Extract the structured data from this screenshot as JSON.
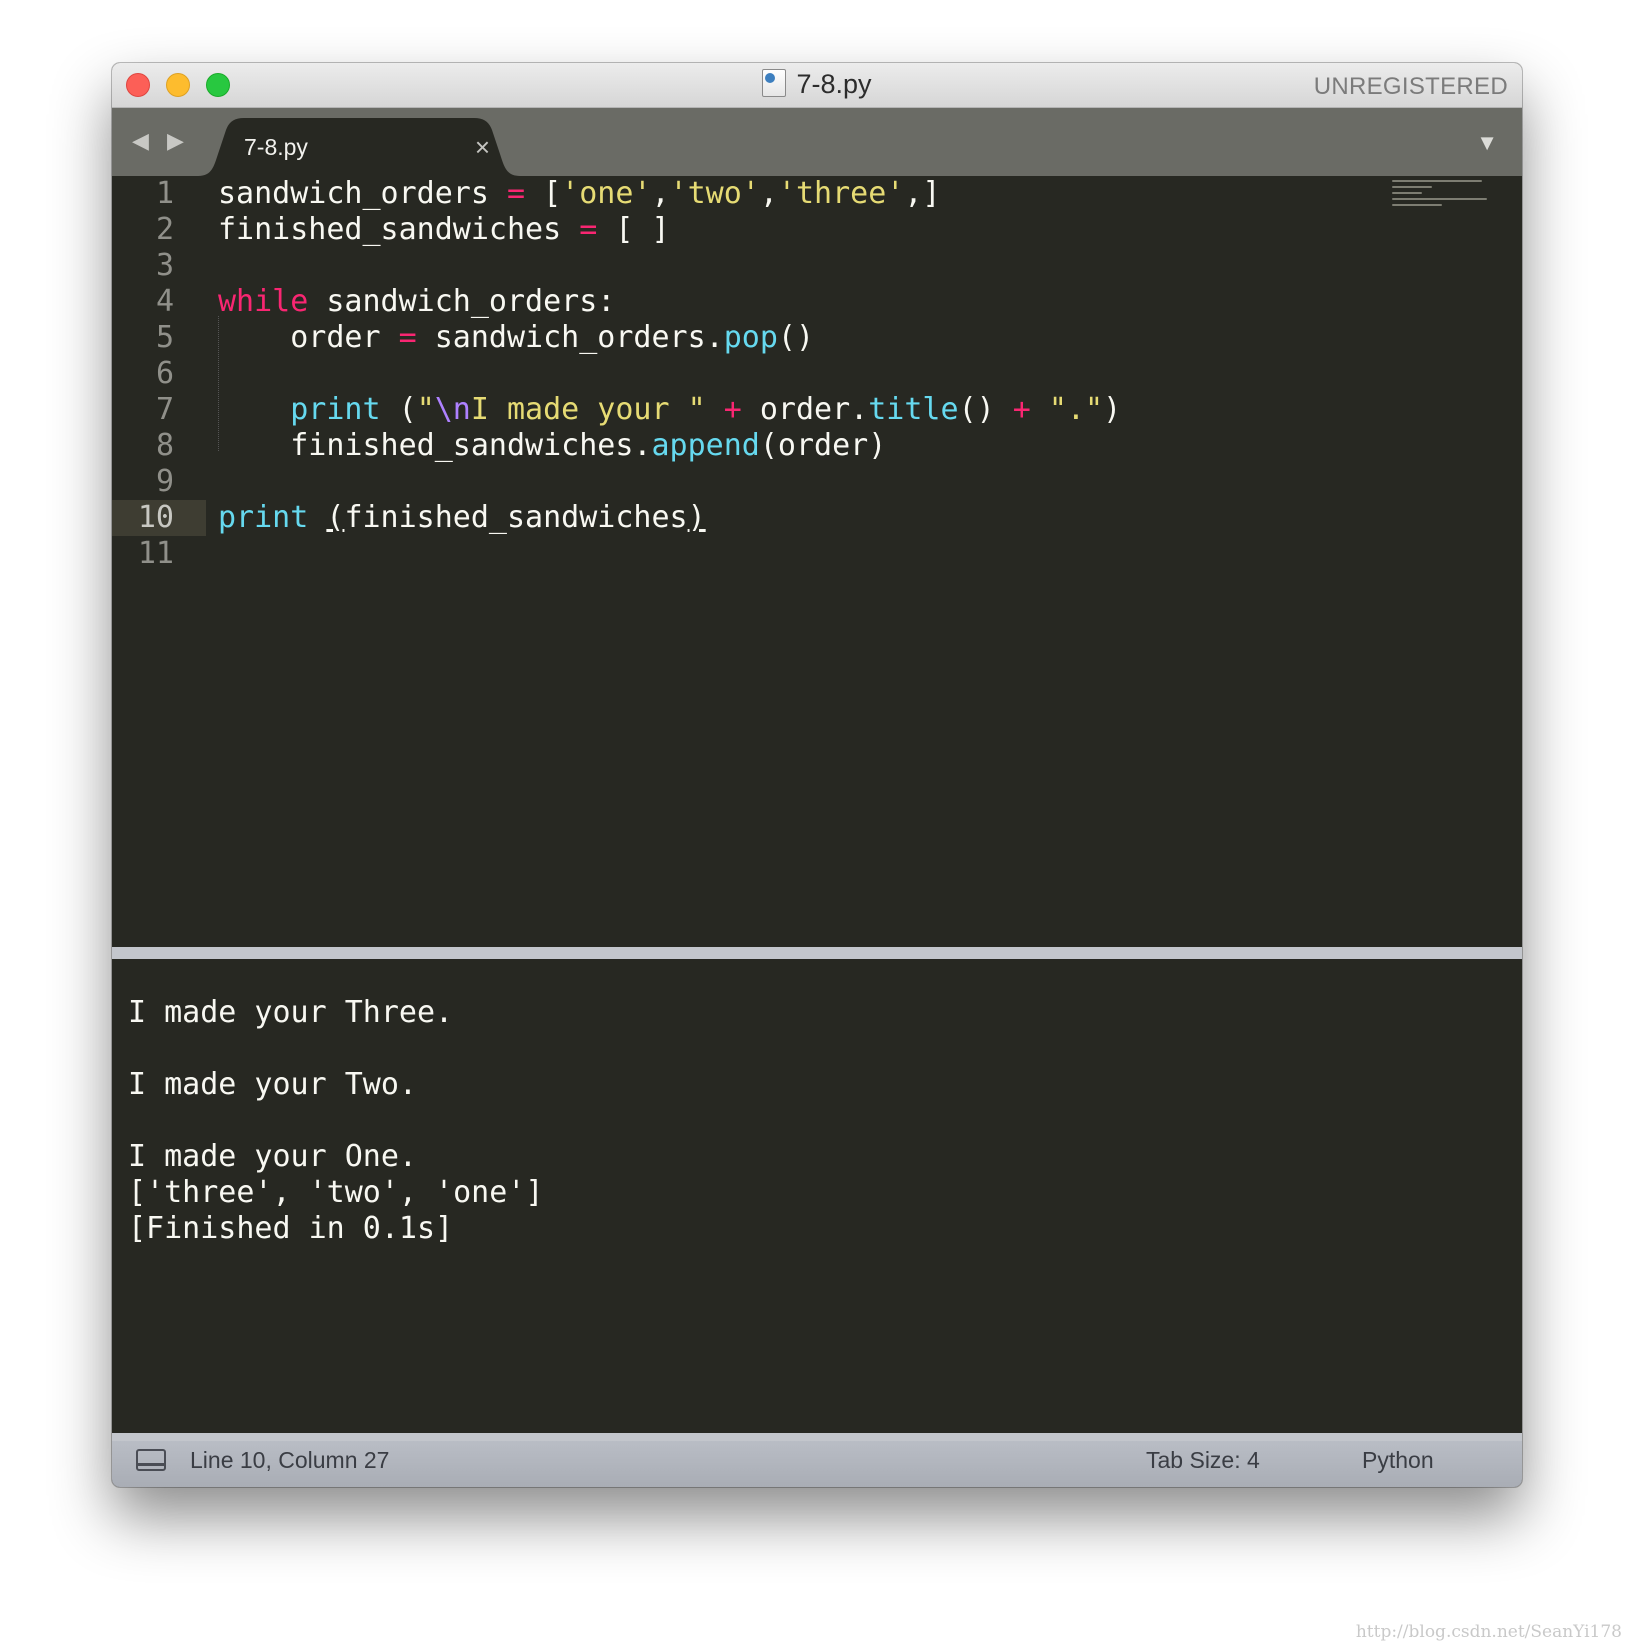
{
  "window": {
    "title": "7-8.py",
    "registration": "UNREGISTERED"
  },
  "tabs": [
    {
      "label": "7-8.py",
      "close_glyph": "×",
      "active": true
    }
  ],
  "tabbar": {
    "nav_glyphs": "◀ ▶",
    "dropdown_glyph": "▼"
  },
  "editor": {
    "current_line": 10,
    "lines": [
      {
        "num": "1"
      },
      {
        "num": "2"
      },
      {
        "num": "3"
      },
      {
        "num": "4"
      },
      {
        "num": "5"
      },
      {
        "num": "6"
      },
      {
        "num": "7"
      },
      {
        "num": "8"
      },
      {
        "num": "9"
      },
      {
        "num": "10"
      },
      {
        "num": "11"
      }
    ],
    "code": {
      "l1": {
        "a": "sandwich_orders ",
        "op": "=",
        "b": " [",
        "s1": "'one'",
        "c1": ",",
        "s2": "'two'",
        "c2": ",",
        "s3": "'three'",
        "end": ",]"
      },
      "l2": {
        "a": "finished_sandwiches ",
        "op": "=",
        "b": " [ ]"
      },
      "l4": {
        "kw": "while",
        "rest": " sandwich_orders:"
      },
      "l5": {
        "a": "    order ",
        "op": "=",
        "b": " sandwich_orders.",
        "fn": "pop",
        "end": "()"
      },
      "l7": {
        "indent": "    ",
        "fn": "print",
        "b": " (",
        "s1": "\"",
        "esc": "\\n",
        "s2": "I made your \"",
        "op1": " +",
        "c": " order.",
        "fn2": "title",
        "d": "()",
        "op2": " +",
        "s3": " \".\"",
        "end": ")"
      },
      "l8": {
        "a": "    finished_sandwiches.",
        "fn": "append",
        "end": "(order)"
      },
      "l10": {
        "fn": "print",
        "sp": " ",
        "paren_open": "(",
        "mid": "finished_sandwiches",
        "paren_close": ")"
      }
    }
  },
  "output": {
    "lines": [
      "",
      "I made your Three.",
      "",
      "I made your Two.",
      "",
      "I made your One.",
      "['three', 'two', 'one']",
      "[Finished in 0.1s]"
    ]
  },
  "statusbar": {
    "position": "Line 10, Column 27",
    "tab_size": "Tab Size: 4",
    "syntax": "Python"
  },
  "watermark": "http://blog.csdn.net/SeanYi178",
  "colors": {
    "background": "#272822",
    "keyword": "#f92672",
    "function": "#66d9ef",
    "string": "#e6db74",
    "escape": "#ae81ff",
    "text": "#f8f8f2"
  }
}
